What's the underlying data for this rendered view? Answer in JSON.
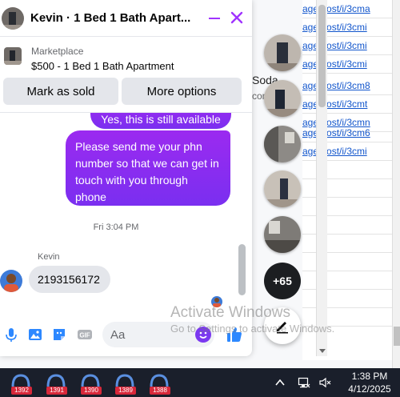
{
  "chat": {
    "title": "Kevin · 1 Bed 1 Bath Apart...",
    "listing_source": "Marketplace",
    "listing_title": "$500 - 1 Bed 1 Bath Apartment",
    "mark_sold_label": "Mark as sold",
    "more_options_label": "More options",
    "prev_message": "Yes, this is still available",
    "main_message": "Please send me your phn number so that we can get in touch with you through phone",
    "timestamp": "Fri 3:04 PM",
    "sender_name": "Kevin",
    "incoming_message": "2193156172",
    "input_placeholder": "Aa",
    "composer_icons": [
      "microphone-icon",
      "photo-icon",
      "sticker-icon",
      "gif-icon",
      "emoji-icon",
      "like-icon"
    ],
    "accent_color": "#8e2fe8"
  },
  "background": {
    "snippet_1": "Soda",
    "snippet_2": "con",
    "links": [
      "age.host/i/3cma",
      "age.host/i/3cmi",
      "age.host/i/3cmi",
      "age.host/i/3cmi",
      "age.host/i/3cm8",
      "age.host/i/3cmt",
      "age.host/i/3cmn",
      "age.host/i/3cm6",
      "age.host/i/3cmi"
    ]
  },
  "chatheads": {
    "more_count": "+65",
    "compose_icon": "compose-icon"
  },
  "watermark": {
    "title": "Activate Windows",
    "subtitle": "Go to Settings to activate Windows."
  },
  "taskbar": {
    "badges": [
      "1392",
      "1391",
      "1390",
      "1389",
      "1388"
    ],
    "tray_icons": [
      "chevron-up-icon",
      "network-icon",
      "volume-muted-icon"
    ],
    "time": "1:38 PM",
    "date": "4/12/2025"
  }
}
